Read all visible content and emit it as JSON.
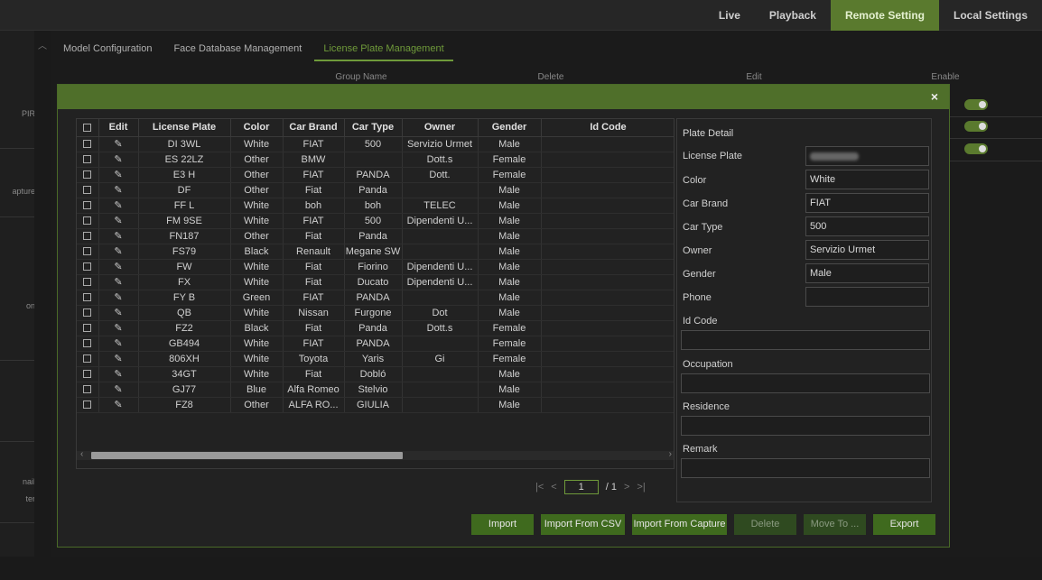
{
  "topnav": [
    "Live",
    "Playback",
    "Remote Setting",
    "Local Settings"
  ],
  "topnav_active": "Remote Setting",
  "left_panel": [
    "PIR",
    "apture",
    "on",
    "nail",
    "ter"
  ],
  "subtabs": [
    "Model Configuration",
    "Face Database Management",
    "License Plate Management"
  ],
  "subtab_active": "License Plate Management",
  "bg_headers": [
    "Group Name",
    "Delete",
    "Edit",
    "Enable"
  ],
  "modal": {
    "close": "×",
    "columns": [
      "Edit",
      "License Plate",
      "Color",
      "Car Brand",
      "Car Type",
      "Owner",
      "Gender",
      "Id Code"
    ],
    "rows": [
      {
        "plate": "DI  3WL",
        "color": "White",
        "brand": "FIAT",
        "type": "500",
        "owner": "Servizio Urmet",
        "gender": "Male"
      },
      {
        "plate": "ES  22LZ",
        "color": "Other",
        "brand": "BMW",
        "type": "",
        "owner": "Dott.s",
        "gender": "Female"
      },
      {
        "plate": "E3   H",
        "color": "Other",
        "brand": "FIAT",
        "type": "PANDA",
        "owner": "Dott.",
        "gender": "Female"
      },
      {
        "plate": "  DF  ",
        "color": "Other",
        "brand": "Fiat",
        "type": "Panda",
        "owner": "",
        "gender": "Male"
      },
      {
        "plate": "FF  L",
        "color": "White",
        "brand": "boh",
        "type": "boh",
        "owner": "TELEC",
        "gender": "Male"
      },
      {
        "plate": "FM  9SE",
        "color": "White",
        "brand": "FIAT",
        "type": "500",
        "owner": "Dipendenti U...",
        "gender": "Male"
      },
      {
        "plate": "FN187",
        "color": "Other",
        "brand": "Fiat",
        "type": "Panda",
        "owner": "",
        "gender": "Male"
      },
      {
        "plate": "FS79",
        "color": "Black",
        "brand": "Renault",
        "type": "Megane SW",
        "owner": "",
        "gender": "Male"
      },
      {
        "plate": "FW",
        "color": "White",
        "brand": "Fiat",
        "type": "Fiorino",
        "owner": "Dipendenti U...",
        "gender": "Male"
      },
      {
        "plate": "FX",
        "color": "White",
        "brand": "Fiat",
        "type": "Ducato",
        "owner": "Dipendenti U...",
        "gender": "Male"
      },
      {
        "plate": "FY   B",
        "color": "Green",
        "brand": "FIAT",
        "type": "PANDA",
        "owner": "",
        "gender": "Male"
      },
      {
        "plate": "   QB",
        "color": "White",
        "brand": "Nissan",
        "type": "Furgone",
        "owner": "Dot",
        "gender": "Male"
      },
      {
        "plate": "FZ2",
        "color": "Black",
        "brand": "Fiat",
        "type": "Panda",
        "owner": "Dott.s",
        "gender": "Female"
      },
      {
        "plate": "GB494",
        "color": "White",
        "brand": "FIAT",
        "type": "PANDA",
        "owner": "",
        "gender": "Female"
      },
      {
        "plate": "  806XH",
        "color": "White",
        "brand": "Toyota",
        "type": "Yaris",
        "owner": "Gi",
        "gender": "Female"
      },
      {
        "plate": "  34GT",
        "color": "White",
        "brand": "Fiat",
        "type": "Dobló",
        "owner": "",
        "gender": "Male"
      },
      {
        "plate": "GJ77",
        "color": "Blue",
        "brand": "Alfa Romeo",
        "type": "Stelvio",
        "owner": "",
        "gender": "Male"
      },
      {
        "plate": "FZ8",
        "color": "Other",
        "brand": "ALFA RO...",
        "type": "GIULIA",
        "owner": "",
        "gender": "Male"
      }
    ],
    "pager": {
      "first": "|<",
      "prev": "<",
      "page": "1",
      "total": "/ 1",
      "next": ">",
      "last": ">|"
    },
    "detail": {
      "title": "Plate Detail",
      "labels": [
        "License Plate",
        "Color",
        "Car Brand",
        "Car Type",
        "Owner",
        "Gender",
        "Phone",
        "Id Code",
        "Occupation",
        "Residence",
        "Remark"
      ],
      "values": {
        "color": "White",
        "brand": "FIAT",
        "type": "500",
        "owner": "Servizio Urmet",
        "gender": "Male"
      }
    },
    "buttons": [
      "Import",
      "Import From CSV",
      "Import From Capture",
      "Delete",
      "Move To ...",
      "Export"
    ]
  }
}
